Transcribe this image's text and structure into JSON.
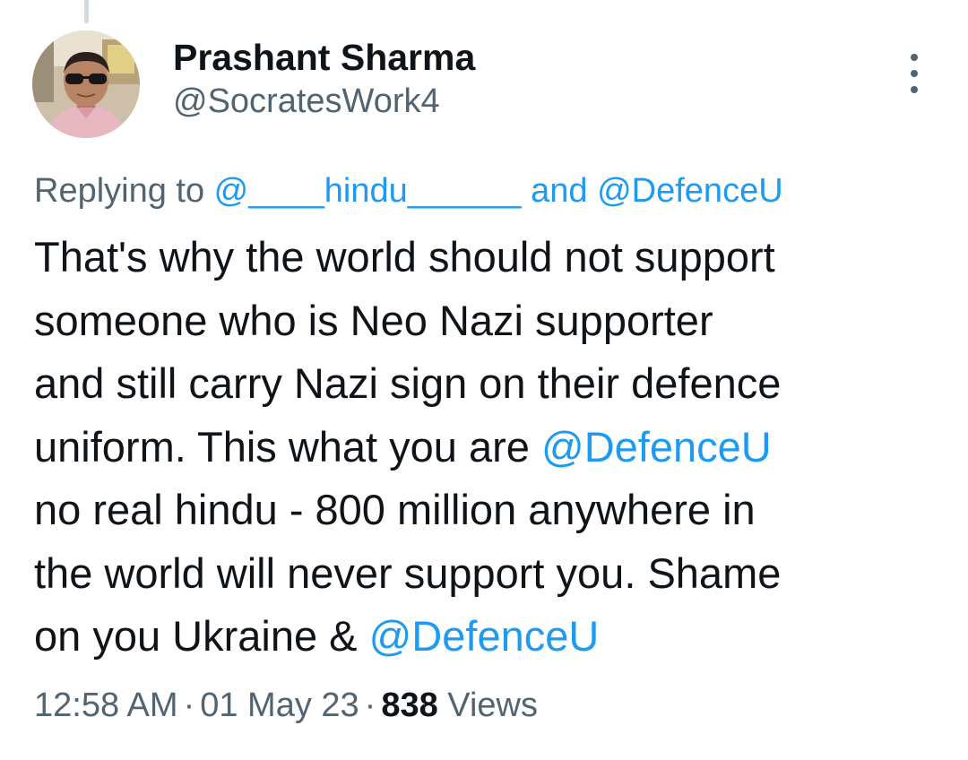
{
  "author": {
    "display_name": "Prashant Sharma",
    "handle": "@SocratesWork4"
  },
  "reply": {
    "prefix": "Replying to ",
    "mention_1": "@____hindu______",
    "joiner": " and ",
    "mention_2": "@DefenceU"
  },
  "tweet": {
    "text_1": "That's why the world should not support\nsomeone who is Neo Nazi supporter\nand still carry Nazi sign on their defence\nuniform. This what you are ",
    "mention_1": "@DefenceU",
    "text_2": "\nno real hindu - 800 million anywhere in\nthe world will never support you. Shame\non you Ukraine & ",
    "mention_2": "@DefenceU"
  },
  "meta": {
    "time": "12:58 AM",
    "separator": "·",
    "date": "01 May 23",
    "views_count": "838",
    "views_label": "Views"
  },
  "icons": {
    "more": "more-vertical-icon"
  },
  "colors": {
    "text": "#0f1419",
    "secondary": "#536471",
    "link": "#1d9bf0"
  }
}
